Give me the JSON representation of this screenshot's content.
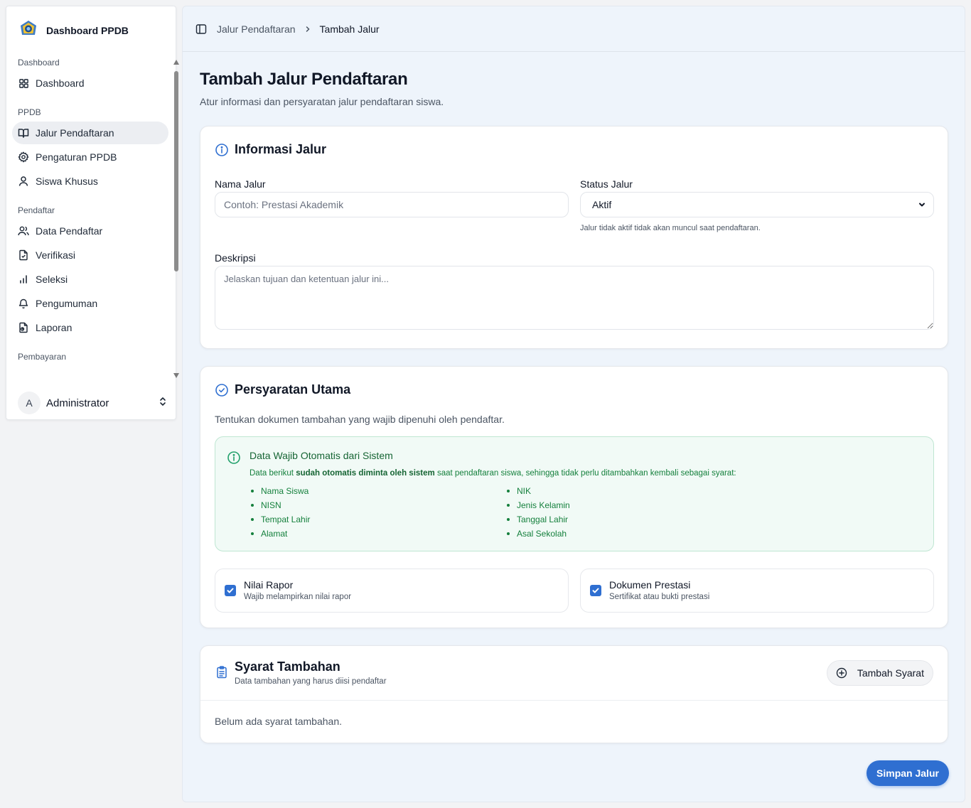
{
  "sidebar": {
    "brand": "Dashboard PPDB",
    "groups": [
      {
        "label": "Dashboard"
      },
      {
        "label": "PPDB"
      },
      {
        "label": "Pendaftar"
      },
      {
        "label": "Pembayaran"
      }
    ],
    "items": [
      {
        "label": "Dashboard",
        "icon": "grid-icon"
      },
      {
        "label": "Jalur Pendaftaran",
        "icon": "book-open-icon",
        "active": true
      },
      {
        "label": "Pengaturan PPDB",
        "icon": "gear-icon"
      },
      {
        "label": "Siswa Khusus",
        "icon": "user-icon"
      },
      {
        "label": "Data Pendaftar",
        "icon": "users-icon"
      },
      {
        "label": "Verifikasi",
        "icon": "file-check-icon"
      },
      {
        "label": "Seleksi",
        "icon": "bar-chart-icon"
      },
      {
        "label": "Pengumuman",
        "icon": "bell-icon"
      },
      {
        "label": "Laporan",
        "icon": "file-report-icon"
      }
    ],
    "user": {
      "initial": "A",
      "name": "Administrator"
    }
  },
  "breadcrumb": {
    "parent": "Jalur Pendaftaran",
    "current": "Tambah Jalur"
  },
  "page": {
    "title": "Tambah Jalur Pendaftaran",
    "subtitle": "Atur informasi dan persyaratan jalur pendaftaran siswa."
  },
  "info_card": {
    "title": "Informasi Jalur",
    "name_label": "Nama Jalur",
    "name_placeholder": "Contoh: Prestasi Akademik",
    "status_label": "Status Jalur",
    "status_value": "Aktif",
    "status_hint": "Jalur tidak aktif tidak akan muncul saat pendaftaran.",
    "desc_label": "Deskripsi",
    "desc_placeholder": "Jelaskan tujuan dan ketentuan jalur ini..."
  },
  "requirements_card": {
    "title": "Persyaratan Utama",
    "description": "Tentukan dokumen tambahan yang wajib dipenuhi oleh pendaftar.",
    "auto_box": {
      "title": "Data Wajib Otomatis dari Sistem",
      "text_before": "Data berikut ",
      "text_bold": "sudah otomatis diminta oleh sistem",
      "text_after": " saat pendaftaran siswa, sehingga tidak perlu ditambahkan kembali sebagai syarat:",
      "left_items": [
        "Nama Siswa",
        "NISN",
        "Tempat Lahir",
        "Alamat"
      ],
      "right_items": [
        "NIK",
        "Jenis Kelamin",
        "Tanggal Lahir",
        "Asal Sekolah"
      ]
    },
    "checks": [
      {
        "title": "Nilai Rapor",
        "subtitle": "Wajib melampirkan nilai rapor",
        "checked": true
      },
      {
        "title": "Dokumen Prestasi",
        "subtitle": "Sertifikat atau bukti prestasi",
        "checked": true
      }
    ]
  },
  "extra_card": {
    "title": "Syarat Tambahan",
    "subtitle": "Data tambahan yang harus diisi pendaftar",
    "add_button": "Tambah Syarat",
    "empty_text": "Belum ada syarat tambahan."
  },
  "save_button": "Simpan Jalur",
  "colors": {
    "accent": "#2f6fd1",
    "success_bg": "#f1faf6",
    "success_text": "#15803d"
  }
}
